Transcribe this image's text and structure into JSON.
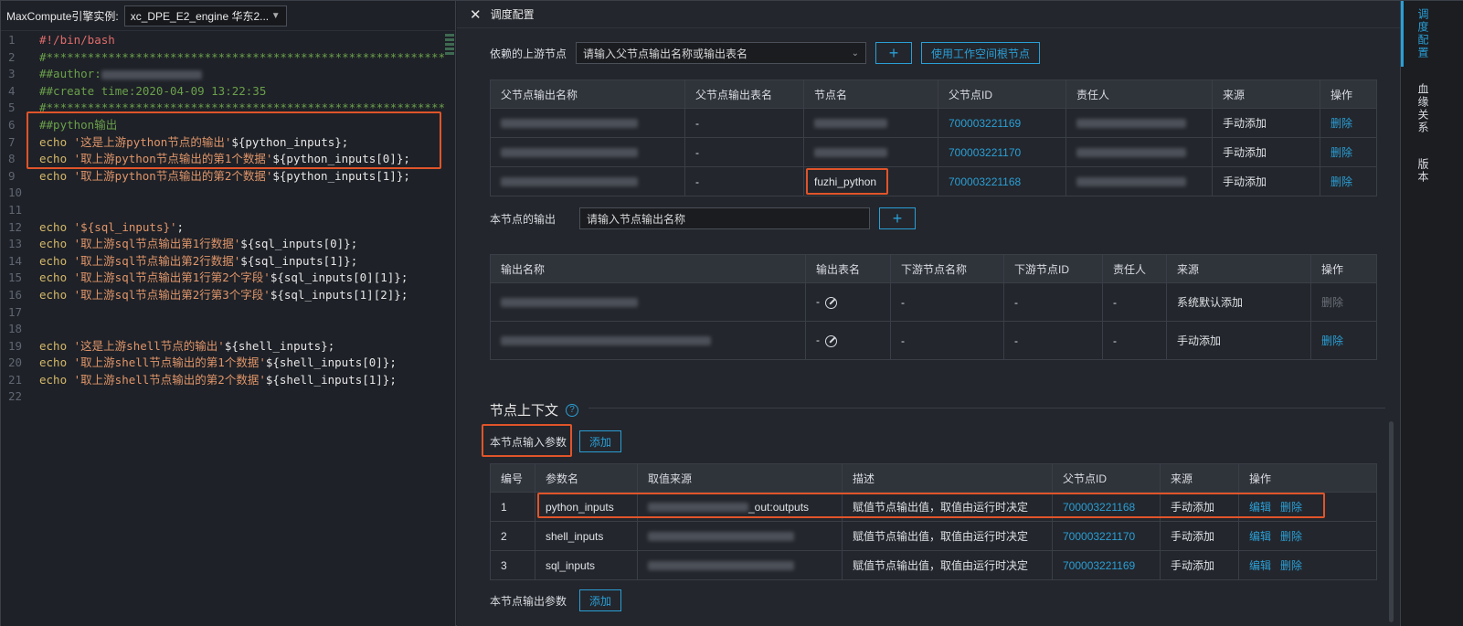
{
  "editor": {
    "engine_label": "MaxCompute引擎实例:",
    "engine_value": "xc_DPE_E2_engine 华东2...",
    "lines": [
      {
        "n": "1",
        "parts": [
          {
            "t": "#!/bin/bash",
            "c": "red"
          }
        ]
      },
      {
        "n": "2",
        "parts": [
          {
            "t": "#****************************************************************",
            "c": "comment"
          }
        ]
      },
      {
        "n": "3",
        "parts": [
          {
            "t": "##author:",
            "c": "comment"
          }
        ]
      },
      {
        "n": "4",
        "parts": [
          {
            "t": "##create time:2020-04-09 13:22:35",
            "c": "comment"
          }
        ]
      },
      {
        "n": "5",
        "parts": [
          {
            "t": "#****************************************************************",
            "c": "comment"
          }
        ]
      },
      {
        "n": "6",
        "parts": [
          {
            "t": "##python输出",
            "c": "comment"
          }
        ]
      },
      {
        "n": "7",
        "parts": [
          {
            "t": "echo ",
            "c": "kw"
          },
          {
            "t": "'这是上游python节点的输出'",
            "c": "str"
          },
          {
            "t": "${python_inputs};",
            "c": "var"
          }
        ]
      },
      {
        "n": "8",
        "parts": [
          {
            "t": "echo ",
            "c": "kw"
          },
          {
            "t": "'取上游python节点输出的第1个数据'",
            "c": "str"
          },
          {
            "t": "${python_inputs[0]};",
            "c": "var"
          }
        ]
      },
      {
        "n": "9",
        "parts": [
          {
            "t": "echo ",
            "c": "kw"
          },
          {
            "t": "'取上游python节点输出的第2个数据'",
            "c": "str"
          },
          {
            "t": "${python_inputs[1]};",
            "c": "var"
          }
        ]
      },
      {
        "n": "10",
        "parts": []
      },
      {
        "n": "11",
        "parts": []
      },
      {
        "n": "12",
        "parts": [
          {
            "t": "echo ",
            "c": "kw"
          },
          {
            "t": "'${sql_inputs}'",
            "c": "str"
          },
          {
            "t": ";",
            "c": "var"
          }
        ]
      },
      {
        "n": "13",
        "parts": [
          {
            "t": "echo ",
            "c": "kw"
          },
          {
            "t": "'取上游sql节点输出第1行数据'",
            "c": "str"
          },
          {
            "t": "${sql_inputs[0]};",
            "c": "var"
          }
        ]
      },
      {
        "n": "14",
        "parts": [
          {
            "t": "echo ",
            "c": "kw"
          },
          {
            "t": "'取上游sql节点输出第2行数据'",
            "c": "str"
          },
          {
            "t": "${sql_inputs[1]};",
            "c": "var"
          }
        ]
      },
      {
        "n": "15",
        "parts": [
          {
            "t": "echo ",
            "c": "kw"
          },
          {
            "t": "'取上游sql节点输出第1行第2个字段'",
            "c": "str"
          },
          {
            "t": "${sql_inputs[0][1]};",
            "c": "var"
          }
        ]
      },
      {
        "n": "16",
        "parts": [
          {
            "t": "echo ",
            "c": "kw"
          },
          {
            "t": "'取上游sql节点输出第2行第3个字段'",
            "c": "str"
          },
          {
            "t": "${sql_inputs[1][2]};",
            "c": "var"
          }
        ]
      },
      {
        "n": "17",
        "parts": []
      },
      {
        "n": "18",
        "parts": []
      },
      {
        "n": "19",
        "parts": [
          {
            "t": "echo ",
            "c": "kw"
          },
          {
            "t": "'这是上游shell节点的输出'",
            "c": "str"
          },
          {
            "t": "${shell_inputs};",
            "c": "var"
          }
        ]
      },
      {
        "n": "20",
        "parts": [
          {
            "t": "echo ",
            "c": "kw"
          },
          {
            "t": "'取上游shell节点输出的第1个数据'",
            "c": "str"
          },
          {
            "t": "${shell_inputs[0]};",
            "c": "var"
          }
        ]
      },
      {
        "n": "21",
        "parts": [
          {
            "t": "echo ",
            "c": "kw"
          },
          {
            "t": "'取上游shell节点输出的第2个数据'",
            "c": "str"
          },
          {
            "t": "${shell_inputs[1]};",
            "c": "var"
          }
        ]
      },
      {
        "n": "22",
        "parts": []
      }
    ]
  },
  "panel": {
    "title": "调度配置",
    "upstream": {
      "label": "依赖的上游节点",
      "placeholder": "请输入父节点输出名称或输出表名",
      "root_button": "使用工作空间根节点"
    },
    "parent_table": {
      "headers": [
        "父节点输出名称",
        "父节点输出表名",
        "节点名",
        "父节点ID",
        "责任人",
        "来源",
        "操作"
      ],
      "rows": [
        {
          "table": "-",
          "node": "",
          "id": "700003221169",
          "source": "手动添加",
          "action": "删除"
        },
        {
          "table": "-",
          "node": "",
          "id": "700003221170",
          "source": "手动添加",
          "action": "删除"
        },
        {
          "table": "-",
          "node": "fuzhi_python",
          "id": "700003221168",
          "source": "手动添加",
          "action": "删除"
        }
      ]
    },
    "output": {
      "label": "本节点的输出",
      "placeholder": "请输入节点输出名称"
    },
    "output_table": {
      "headers": [
        "输出名称",
        "输出表名",
        "下游节点名称",
        "下游节点ID",
        "责任人",
        "来源",
        "操作"
      ],
      "rows": [
        {
          "table": "-",
          "down_name": "-",
          "down_id": "-",
          "owner": "-",
          "source": "系统默认添加",
          "action": "删除",
          "action_disabled": true
        },
        {
          "table": "-",
          "down_name": "-",
          "down_id": "-",
          "owner": "-",
          "source": "手动添加",
          "action": "删除",
          "action_disabled": false
        }
      ]
    },
    "context": {
      "title": "节点上下文",
      "input_label": "本节点输入参数",
      "add_label": "添加",
      "output_label": "本节点输出参数",
      "headers": [
        "编号",
        "参数名",
        "取值来源",
        "描述",
        "父节点ID",
        "来源",
        "操作"
      ],
      "rows": [
        {
          "no": "1",
          "name": "python_inputs",
          "value": "_out:outputs",
          "desc": "赋值节点输出值，取值由运行时决定",
          "id": "700003221168",
          "source": "手动添加",
          "edit": "编辑",
          "del": "删除"
        },
        {
          "no": "2",
          "name": "shell_inputs",
          "value": "",
          "desc": "赋值节点输出值，取值由运行时决定",
          "id": "700003221170",
          "source": "手动添加",
          "edit": "编辑",
          "del": "删除"
        },
        {
          "no": "3",
          "name": "sql_inputs",
          "value": "",
          "desc": "赋值节点输出值，取值由运行时决定",
          "id": "700003221169",
          "source": "手动添加",
          "edit": "编辑",
          "del": "删除"
        }
      ]
    }
  },
  "rail": {
    "items": [
      "调度配置",
      "血缘关系",
      "版本"
    ]
  }
}
